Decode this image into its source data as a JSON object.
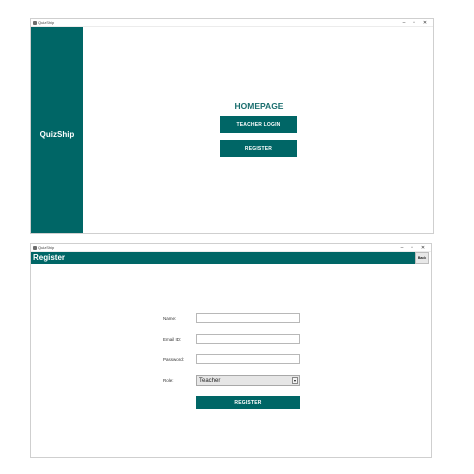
{
  "colors": {
    "accent": "#006666",
    "heading": "#1a6e6e"
  },
  "window_controls": {
    "minimize": "–",
    "maximize": "▫",
    "close": "✕"
  },
  "home_window": {
    "title": "QuizShip",
    "app_name": "QuizShip",
    "heading": "HOMEPAGE",
    "teacher_login_label": "TEACHER LOGIN",
    "register_label": "REGISTER"
  },
  "register_window": {
    "title": "QuizShip",
    "header": "Register",
    "back_label": "Back",
    "fields": {
      "name_label": "Name:",
      "name_value": "",
      "email_label": "Email ID:",
      "email_value": "",
      "password_label": "Password:",
      "password_value": "",
      "role_label": "Role:",
      "role_value": "Teacher"
    },
    "dropdown_icon": "▼",
    "register_label": "REGISTER"
  }
}
